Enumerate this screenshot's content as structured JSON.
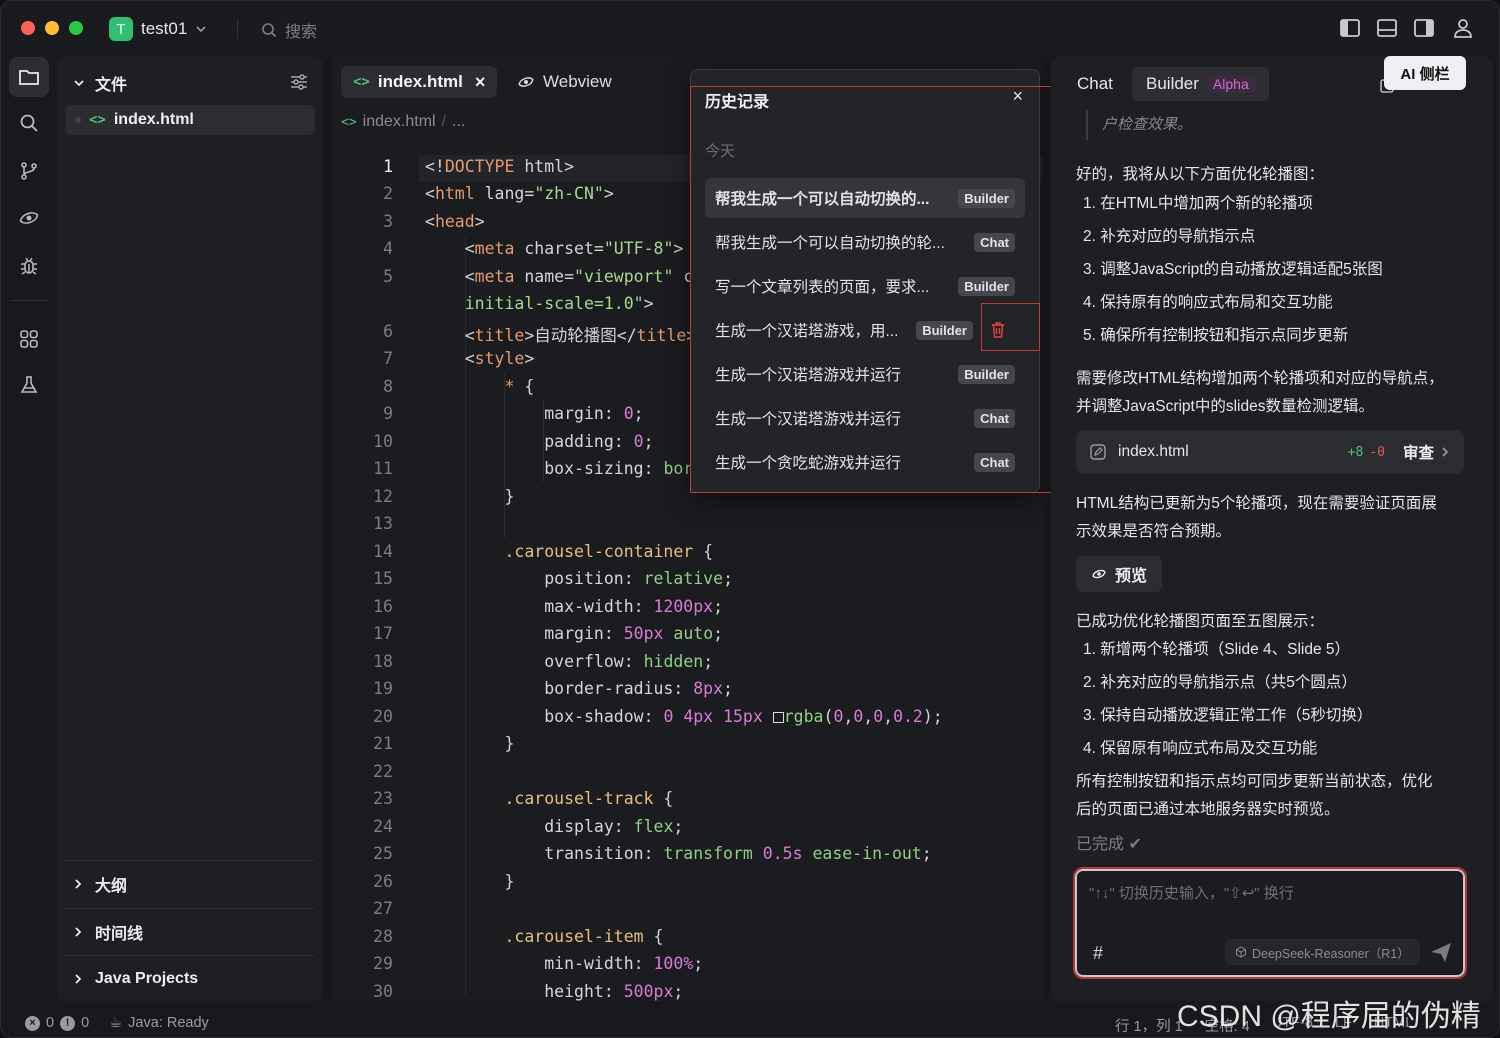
{
  "window": {
    "project": {
      "badge": "T",
      "name": "test01"
    },
    "search_placeholder": "搜索"
  },
  "activity": [
    "folder-icon",
    "search-icon",
    "branch-icon",
    "eye-icon",
    "bug-icon",
    "apps-icon",
    "flask-icon"
  ],
  "explorer": {
    "title": "文件",
    "file": "index.html",
    "sections": [
      "大纲",
      "时间线",
      "Java Projects"
    ]
  },
  "editor": {
    "tabs": [
      {
        "label": "index.html",
        "close": "×"
      },
      {
        "label": "Webview"
      }
    ],
    "breadcrumb": {
      "file": "index.html",
      "sep": "/",
      "more": "..."
    },
    "line_numbers": [
      "1",
      "2",
      "3",
      "4",
      "5",
      "",
      "6",
      "7",
      "8",
      "9",
      "10",
      "11",
      "12",
      "13",
      "14",
      "15",
      "16",
      "17",
      "18",
      "19",
      "20",
      "21",
      "22",
      "23",
      "24",
      "25",
      "26",
      "27",
      "28",
      "29",
      "30"
    ]
  },
  "history": {
    "title": "历史记录",
    "close": "×",
    "group": "今天",
    "items": [
      {
        "text": "帮我生成一个可以自动切换的...",
        "tag": "Builder"
      },
      {
        "text": "帮我生成一个可以自动切换的轮...",
        "tag": "Chat"
      },
      {
        "text": "写一个文章列表的页面，要求...",
        "tag": "Builder"
      },
      {
        "text": "生成一个汉诺塔游戏，用...",
        "tag": "Builder"
      },
      {
        "text": "生成一个汉诺塔游戏并运行",
        "tag": "Builder"
      },
      {
        "text": "生成一个汉诺塔游戏并运行",
        "tag": "Chat"
      },
      {
        "text": "生成一个贪吃蛇游戏并运行",
        "tag": "Chat"
      }
    ]
  },
  "ai": {
    "tabs": {
      "chat": "Chat",
      "builder": "Builder",
      "alpha": "Alpha"
    },
    "tooltip": "AI 侧栏",
    "quote": "户检查效果。",
    "intro": "好的，我将从以下方面优化轮播图：",
    "steps": [
      "1. 在HTML中增加两个新的轮播项",
      "2. 补充对应的导航指示点",
      "3. 调整JavaScript的自动播放逻辑适配5张图",
      "4. 保持原有的响应式布局和交互功能",
      "5. 确保所有控制按钮和指示点同步更新"
    ],
    "para1": [
      "需要修改HTML结构增加两个轮播项和对应的导航点，",
      "并调整JavaScript中的slides数量检测逻辑。"
    ],
    "file": {
      "name": "index.html",
      "added": "+8",
      "removed": "-0",
      "review": "审查"
    },
    "para2": [
      "HTML结构已更新为5个轮播项，现在需要验证页面展",
      "示效果是否符合预期。"
    ],
    "preview": "预览",
    "summary_title": "已成功优化轮播图页面至五图展示：",
    "summary": [
      "1. 新增两个轮播项（Slide 4、Slide 5）",
      "2. 补充对应的导航指示点（共5个圆点）",
      "3. 保持自动播放逻辑正常工作（5秒切换）",
      "4. 保留原有响应式布局及交互功能"
    ],
    "para3": [
      "所有控制按钮和指示点均可同步更新当前状态，优化",
      "后的页面已通过本地服务器实时预览。"
    ],
    "done": "已完成",
    "input": {
      "placeholder": "\"↑↓\" 切换历史输入，\"⇧↩\" 换行",
      "hash": "#",
      "model": "DeepSeek-Reasoner（R1）"
    }
  },
  "status": {
    "errors": "0",
    "warnings": "0",
    "java": "Java: Ready",
    "position": "行 1，列 1",
    "spaces": "空格: 4",
    "encoding": "UTF-8",
    "eol": "LF",
    "lang": "HTML"
  },
  "watermark": "CSDN @程序届的伪精英",
  "colors": {
    "accent_red": "#c2393a",
    "green_badge": "#2fbf71",
    "alpha": "#d46bd0"
  }
}
